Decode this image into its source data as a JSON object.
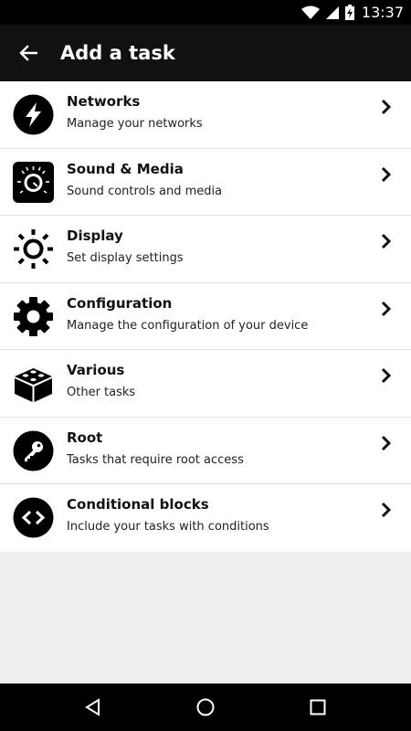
{
  "status_bar": {
    "time": "13:37",
    "icons": [
      "wifi-icon",
      "signal-icon",
      "battery-charging-icon"
    ]
  },
  "app_bar": {
    "title": "Add a task",
    "back_icon": "arrow-back-icon"
  },
  "categories": [
    {
      "icon": "lightning-icon",
      "title": "Networks",
      "subtitle": "Manage your networks"
    },
    {
      "icon": "knob-icon",
      "title": "Sound & Media",
      "subtitle": "Sound controls and media"
    },
    {
      "icon": "sun-icon",
      "title": "Display",
      "subtitle": "Set display settings"
    },
    {
      "icon": "gear-icon",
      "title": "Configuration",
      "subtitle": "Manage the configuration of your device"
    },
    {
      "icon": "brick-icon",
      "title": "Various",
      "subtitle": "Other tasks"
    },
    {
      "icon": "key-icon",
      "title": "Root",
      "subtitle": "Tasks that require root access"
    },
    {
      "icon": "code-brackets-icon",
      "title": "Conditional blocks",
      "subtitle": "Include your tasks with conditions"
    }
  ],
  "nav_bar": {
    "icons": [
      "back-triangle-icon",
      "home-circle-icon",
      "recents-square-icon"
    ]
  },
  "colors": {
    "status_bar": "#000000",
    "app_bar": "#111111",
    "list_background": "#ffffff",
    "page_background": "#eeeeee",
    "text_primary": "#111111"
  }
}
